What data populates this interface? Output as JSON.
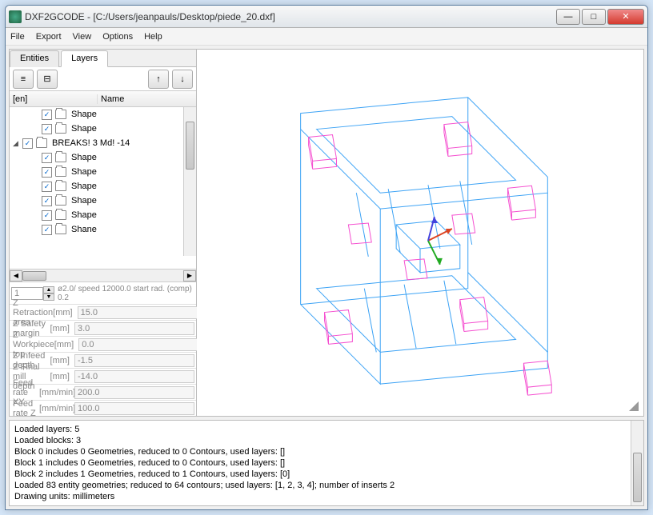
{
  "title": "DXF2GCODE - [C:/Users/jeanpauls/Desktop/piede_20.dxf]",
  "menu": {
    "file": "File",
    "export": "Export",
    "view": "View",
    "options": "Options",
    "help": "Help"
  },
  "tabs": {
    "entities": "Entities",
    "layers": "Layers"
  },
  "tree": {
    "header_col1": "[en]",
    "header_col2": "Name",
    "rows": [
      {
        "expand": "",
        "indent": 2,
        "name": "Shape"
      },
      {
        "expand": "",
        "indent": 2,
        "name": "Shape"
      },
      {
        "expand": "◢",
        "indent": 0,
        "name": "BREAKS! 3 Md! -14"
      },
      {
        "expand": "",
        "indent": 2,
        "name": "Shape"
      },
      {
        "expand": "",
        "indent": 2,
        "name": "Shape"
      },
      {
        "expand": "",
        "indent": 2,
        "name": "Shape"
      },
      {
        "expand": "",
        "indent": 2,
        "name": "Shape"
      },
      {
        "expand": "",
        "indent": 2,
        "name": "Shape"
      },
      {
        "expand": "",
        "indent": 2,
        "name": "Shane"
      }
    ]
  },
  "spinner": {
    "value": "1",
    "desc": "ø2.0/ speed 12000.0 start rad. (comp) 0.2"
  },
  "params": [
    {
      "label": "Z Retraction area",
      "unit": "[mm]",
      "value": "15.0"
    },
    {
      "label": "Z Safety margin",
      "unit": "[mm]",
      "value": "3.0"
    },
    {
      "label": "Z Workpiece top",
      "unit": "[mm]",
      "value": "0.0"
    },
    {
      "label": "Z Infeed depth",
      "unit": "[mm]",
      "value": "-1.5"
    },
    {
      "label": "Z Final mill depth",
      "unit": "[mm]",
      "value": "-14.0"
    },
    {
      "label": "Feed rate XY",
      "unit": "[mm/min]",
      "value": "200.0"
    },
    {
      "label": "Feed rate Z",
      "unit": "[mm/min]",
      "value": "100.0"
    }
  ],
  "console": [
    "Loaded layers: 5",
    "Loaded blocks: 3",
    "Block 0 includes 0 Geometries, reduced to 0 Contours, used layers: []",
    "Block 1 includes 0 Geometries, reduced to 0 Contours, used layers: []",
    "Block 2 includes 1 Geometries, reduced to 1 Contours, used layers: [0]",
    "Loaded 83 entity geometries; reduced to 64 contours; used layers: [1, 2, 3, 4]; number of inserts 2",
    "Drawing units: millimeters"
  ]
}
